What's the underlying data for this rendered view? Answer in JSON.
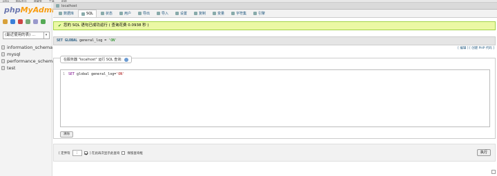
{
  "browser": {
    "items": [
      "pma",
      "新标签页",
      "收藏夹",
      "工具",
      "帮助"
    ]
  },
  "sidebar": {
    "logo_php": "php",
    "logo_admin": "MyAdmin",
    "recent_label": "(最近使用的表) ...",
    "databases": [
      "information_schema",
      "mysql",
      "performance_schema",
      "test"
    ]
  },
  "topbar": {
    "server": "localhost"
  },
  "tabs": [
    {
      "label": "数据库",
      "icon": "database-icon"
    },
    {
      "label": "SQL",
      "icon": "sql-icon"
    },
    {
      "label": "状态",
      "icon": "status-icon"
    },
    {
      "label": "用户",
      "icon": "users-icon"
    },
    {
      "label": "导出",
      "icon": "export-icon"
    },
    {
      "label": "导入",
      "icon": "import-icon"
    },
    {
      "label": "设置",
      "icon": "settings-icon"
    },
    {
      "label": "复制",
      "icon": "replication-icon"
    },
    {
      "label": "变量",
      "icon": "variables-icon"
    },
    {
      "label": "字符集",
      "icon": "charset-icon"
    },
    {
      "label": "引擎",
      "icon": "engine-icon"
    }
  ],
  "success": {
    "message": "您的 SQL 语句已成功运行 ( 查询花费 0.0938 秒 )"
  },
  "query": {
    "kw": "SET GLOBAL",
    "rest": " general_log = ",
    "value": "'ON'"
  },
  "links": {
    "text": "[ 编辑 ] [ 创建 PHP 代码 ]"
  },
  "panel": {
    "legend": "在服务器 \"localhost\" 运行 SQL 查询:",
    "line_no": "1",
    "code_kw": "SET",
    "code_rest": " global general_log=",
    "code_str": "'ON'",
    "clear_label": "清除"
  },
  "bottom": {
    "delimiter_label": "[ 定界符",
    "delimiter_value": ";",
    "show_again_label": "] 在此再次显示此查询",
    "keep_box_label": "保留查询框",
    "go_label": "执行"
  },
  "colors": {
    "accent": "#235a81",
    "success_bg": "#ebf8a4",
    "logo_blue": "#6c78af",
    "logo_orange": "#f89c0e"
  }
}
